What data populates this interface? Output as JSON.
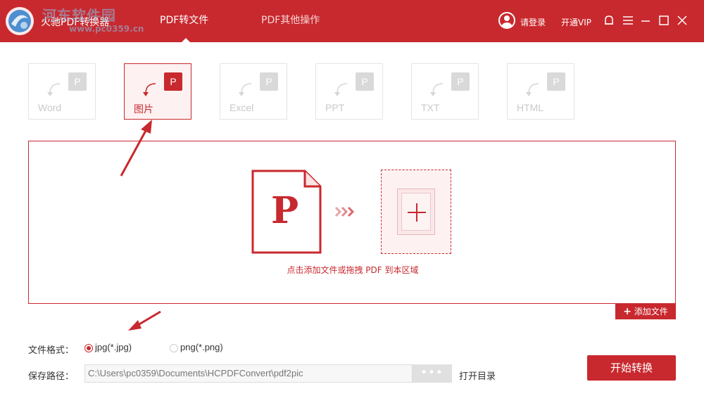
{
  "window": {
    "app_title": "火驰PDF转换器",
    "watermark": "河东软件园",
    "watermark_url": "www.pc0359.cn"
  },
  "nav": {
    "tabs": [
      {
        "label": "PDF转文件",
        "active": true
      },
      {
        "label": "PDF其他操作",
        "active": false
      }
    ]
  },
  "header_actions": {
    "login": "请登录",
    "vip": "开通VIP"
  },
  "formats": [
    {
      "label": "Word",
      "badge": "P",
      "active": false
    },
    {
      "label": "图片",
      "badge": "P",
      "active": true
    },
    {
      "label": "Excel",
      "badge": "P",
      "active": false
    },
    {
      "label": "PPT",
      "badge": "P",
      "active": false
    },
    {
      "label": "TXT",
      "badge": "P",
      "active": false
    },
    {
      "label": "HTML",
      "badge": "P",
      "active": false
    }
  ],
  "dropzone": {
    "pdf_letter": "P",
    "hint": "点击添加文件或拖拽 PDF 到本区域"
  },
  "add_file_button": "添加文件",
  "options": {
    "format_label": "文件格式：",
    "format_choices": [
      {
        "label": "jpg(*.jpg)",
        "checked": true
      },
      {
        "label": "png(*.png)",
        "checked": false
      }
    ],
    "save_path_label": "保存路径：",
    "save_path": "C:\\Users\\pc0359\\Documents\\HCPDFConvert\\pdf2pic",
    "browse_label": "•••",
    "open_dir_label": "打开目录"
  },
  "start_button": "开始转换",
  "colors": {
    "brand": "#c8292e",
    "tile_active_bg": "#fdf1f1",
    "disabled": "#c9c9c9"
  }
}
